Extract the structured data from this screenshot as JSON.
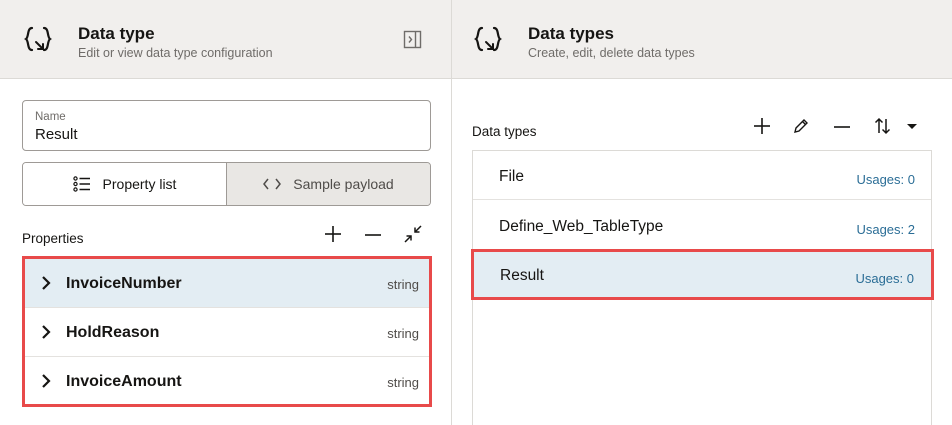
{
  "left_panel": {
    "title": "Data type",
    "subtitle": "Edit or view data type configuration",
    "icon": "curly-braces-icon",
    "name_field": {
      "label": "Name",
      "value": "Result"
    },
    "tabs": [
      {
        "label": "Property list",
        "icon": "list-icon",
        "active": true
      },
      {
        "label": "Sample payload",
        "icon": "code-icon",
        "active": false
      }
    ],
    "properties_label": "Properties",
    "properties": [
      {
        "name": "InvoiceNumber",
        "type": "string",
        "selected": true
      },
      {
        "name": "HoldReason",
        "type": "string",
        "selected": false
      },
      {
        "name": "InvoiceAmount",
        "type": "string",
        "selected": false
      }
    ]
  },
  "right_panel": {
    "title": "Data types",
    "subtitle": "Create, edit, delete data types",
    "icon": "curly-braces-icon",
    "list_label": "Data types",
    "items": [
      {
        "name": "File",
        "usages": "Usages: 0"
      },
      {
        "name": "Define_Web_TableType",
        "usages": "Usages: 2"
      },
      {
        "name": "Result",
        "usages": "Usages: 0",
        "selected": true
      }
    ]
  },
  "colors": {
    "header_bg": "#f1efed",
    "selection_bg": "#e3edf3",
    "highlight_border": "#e84a4a",
    "link_blue": "#2a6d96"
  }
}
